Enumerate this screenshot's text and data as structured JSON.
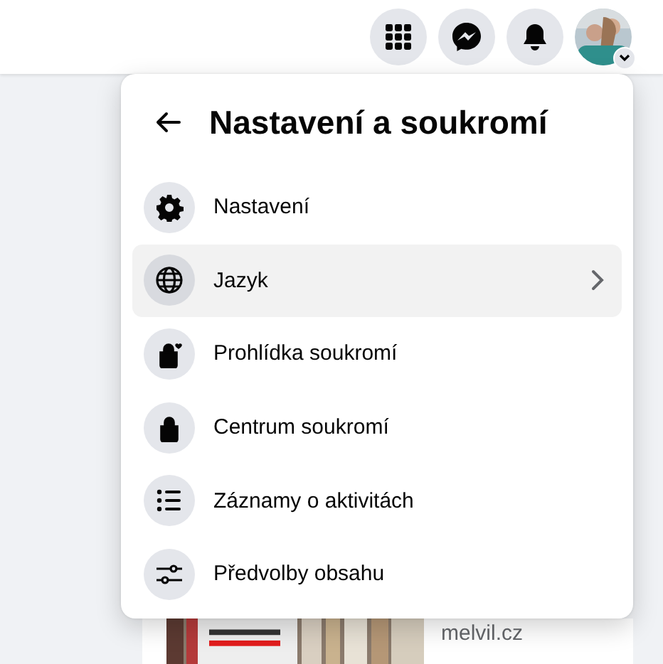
{
  "top_bar": {
    "buttons": [
      {
        "kind": "menu"
      },
      {
        "kind": "messenger"
      },
      {
        "kind": "notifications"
      },
      {
        "kind": "account"
      }
    ]
  },
  "feed": {
    "link_domain": "melvil.cz"
  },
  "menu": {
    "title": "Nastavení a soukromí",
    "items": [
      {
        "label": "Nastavení",
        "kind": "gear",
        "highlighted": false,
        "submenu": false
      },
      {
        "label": "Jazyk",
        "kind": "globe",
        "highlighted": true,
        "submenu": true
      },
      {
        "label": "Prohlídka soukromí",
        "kind": "lock-heart",
        "highlighted": false,
        "submenu": false
      },
      {
        "label": "Centrum soukromí",
        "kind": "lock",
        "highlighted": false,
        "submenu": false
      },
      {
        "label": "Záznamy o aktivitách",
        "kind": "list",
        "highlighted": false,
        "submenu": false
      },
      {
        "label": "Předvolby obsahu",
        "kind": "sliders",
        "highlighted": false,
        "submenu": false
      }
    ]
  }
}
